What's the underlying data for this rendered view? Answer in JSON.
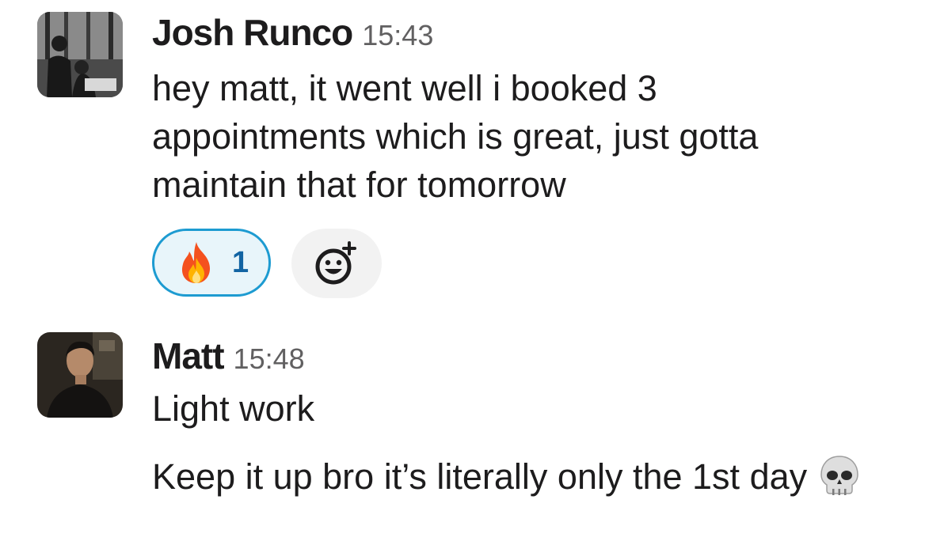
{
  "messages": [
    {
      "sender": "Josh Runco",
      "time": "15:43",
      "avatar_icon": "user-photo-josh",
      "lines": [
        "hey matt, it went well i booked 3 appointments which is great, just gotta maintain that for tomorrow"
      ],
      "reactions": [
        {
          "emoji_name": "fire-icon",
          "count": "1",
          "active": true
        }
      ],
      "add_reaction_icon": "add-reaction-icon"
    },
    {
      "sender": "Matt",
      "time": "15:48",
      "avatar_icon": "user-photo-matt",
      "lines": [
        "Light work",
        "Keep it up bro it’s literally only the 1st day"
      ],
      "inline_emoji": "skull-icon"
    }
  ],
  "colors": {
    "reaction_border": "#1d9bd1",
    "reaction_bg": "#e8f5fa",
    "reaction_count": "#1264a3",
    "timestamp": "#616061",
    "text": "#1d1c1d"
  }
}
